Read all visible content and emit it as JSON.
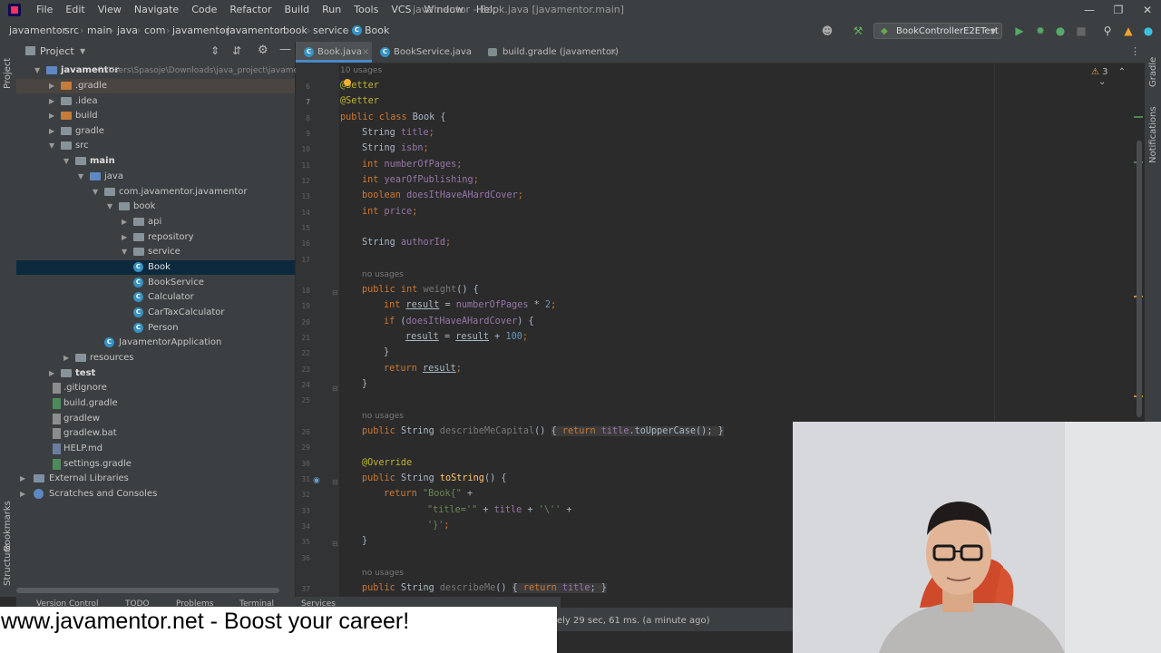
{
  "menu": [
    "File",
    "Edit",
    "View",
    "Navigate",
    "Code",
    "Refactor",
    "Build",
    "Run",
    "Tools",
    "VCS",
    "Window",
    "Help"
  ],
  "window_title": "javamentor - Book.java [javamentor.main]",
  "breadcrumbs": [
    "javamentor",
    "src",
    "main",
    "java",
    "com",
    "javamentor",
    "javamentor",
    "book",
    "service",
    "Book"
  ],
  "run_config": "BookControllerE2ETest",
  "project_panel": {
    "title": "Project",
    "root_label": "javamentor",
    "root_path": "C:\\Users\\Spasoje\\Downloads\\java_project\\javame",
    "tree": [
      {
        "label": ".gradle"
      },
      {
        "label": ".idea"
      },
      {
        "label": "build"
      },
      {
        "label": "gradle"
      },
      {
        "label": "src"
      },
      {
        "label": "main"
      },
      {
        "label": "java"
      },
      {
        "label": "com.javamentor.javamentor"
      },
      {
        "label": "book"
      },
      {
        "label": "api"
      },
      {
        "label": "repository"
      },
      {
        "label": "service"
      },
      {
        "label": "Book"
      },
      {
        "label": "BookService"
      },
      {
        "label": "Calculator"
      },
      {
        "label": "CarTaxCalculator"
      },
      {
        "label": "Person"
      },
      {
        "label": "JavamentorApplication"
      },
      {
        "label": "resources"
      },
      {
        "label": "test"
      },
      {
        "label": ".gitignore"
      },
      {
        "label": "build.gradle"
      },
      {
        "label": "gradlew"
      },
      {
        "label": "gradlew.bat"
      },
      {
        "label": "HELP.md"
      },
      {
        "label": "settings.gradle"
      },
      {
        "label": "External Libraries"
      },
      {
        "label": "Scratches and Consoles"
      }
    ]
  },
  "tabs": [
    "Book.java",
    "BookService.java",
    "build.gradle (javamentor)"
  ],
  "editor": {
    "usages_top": "10 usages",
    "warnings_count": "3",
    "line_numbers": [
      "6",
      "7",
      "8",
      "9",
      "10",
      "11",
      "12",
      "13",
      "14",
      "15",
      "16",
      "17",
      "18",
      "19",
      "20",
      "21",
      "22",
      "23",
      "24",
      "25",
      "26",
      "29",
      "30",
      "31",
      "32",
      "33",
      "34",
      "35",
      "36",
      "37"
    ],
    "no_usages": "no usages",
    "code": {
      "l6": "@Setter",
      "l7": "@Setter",
      "l8_kw": "public class",
      "l8_name": " Book {",
      "l9_t": "String ",
      "l9_f": "title",
      "l9_e": ";",
      "l10_t": "String ",
      "l10_f": "isbn",
      "l10_e": ";",
      "l11_t": "int ",
      "l11_f": "numberOfPages",
      "l11_e": ";",
      "l12_t": "int ",
      "l12_f": "yearOfPublishing",
      "l12_e": ";",
      "l13_t": "boolean ",
      "l13_f": "doesItHaveAHardCover",
      "l13_e": ";",
      "l14_t": "int ",
      "l14_f": "price",
      "l14_e": ";",
      "l16_t": "String ",
      "l16_f": "authorId",
      "l16_e": ";",
      "l18_kw": "public int ",
      "l18_fn": "weight",
      "l18_e": "() {",
      "l19_kw": "int ",
      "l19_v": "result",
      "l19_m": " = ",
      "l19_f": "numberOfPages",
      "l19_op": " * ",
      "l19_n": "2",
      "l19_e": ";",
      "l20_kw": "if ",
      "l20_a": "(",
      "l20_f": "doesItHaveAHardCover",
      "l20_e": ") {",
      "l21_v": "result",
      "l21_m": " = ",
      "l21_v2": "result",
      "l21_op": " + ",
      "l21_n": "100",
      "l21_e": ";",
      "l22": "}",
      "l23_kw": "return ",
      "l23_v": "result",
      "l23_e": ";",
      "l24": "}",
      "l26_kw": "public ",
      "l26_t": "String ",
      "l26_fn": "describeMeCapital",
      "l26_a": "() ",
      "l26_b": "{ ",
      "l26_kw2": "return ",
      "l26_f": "title",
      "l26_c": ".toUpperCase(); ",
      "l26_d": "}",
      "l30": "@Override",
      "l31_kw": "public ",
      "l31_t": "String ",
      "l31_fn": "toString",
      "l31_e": "() {",
      "l32_kw": "return ",
      "l32_s": "\"Book{\"",
      "l32_e": " +",
      "l33_s": "\"title='\"",
      "l33_m": " + ",
      "l33_f": "title",
      "l33_m2": " + ",
      "l33_s2": "'\\''",
      "l33_e": " +",
      "l34_s": "'}'",
      "l34_e": ";",
      "l35": "}",
      "l37_kw": "public ",
      "l37_t": "String ",
      "l37_fn": "describeMe",
      "l37_a": "() ",
      "l37_b": "{ ",
      "l37_kw2": "return ",
      "l37_f": "title",
      "l37_c": "; ",
      "l37_d": "}"
    }
  },
  "bottom_tabs": [
    "Version Control",
    "TODO",
    "Problems",
    "Terminal",
    "Services"
  ],
  "status_text": "ely 29 sec, 61 ms. (a minute ago)",
  "ad_text": "www.javamentor.net - Boost your career!",
  "side_labels": {
    "project": "Project",
    "bookmarks": "Bookmarks",
    "structure": "Structure",
    "gradle": "Gradle",
    "notifications": "Notifications"
  },
  "colors": {
    "accent": "#4a88c7",
    "keyword": "#cc7832",
    "annotation": "#bbb529",
    "field": "#9876aa",
    "method": "#ffc66d",
    "string": "#6a8759",
    "number": "#6897bb"
  }
}
